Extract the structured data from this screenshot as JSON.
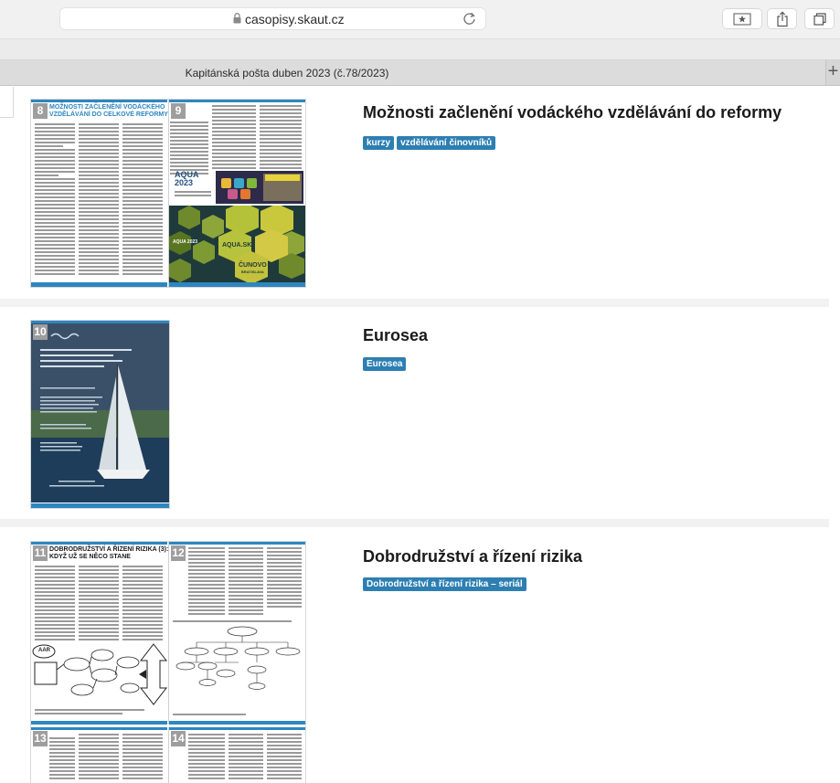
{
  "browser": {
    "url": "casopisy.skaut.cz",
    "tab_title": "Kapitánská pošta duben 2023 (č.78/2023)",
    "new_tab_symbol": "+"
  },
  "articles": [
    {
      "title": "Možnosti začlenění vodáckého vzdělávání do reformy",
      "tags": [
        "kurzy",
        "vzdělávání činovníků"
      ],
      "thumb": {
        "page_left": "8",
        "page_right": "9",
        "heading_line1": "MOŽNOSTI ZAČLENĚNÍ VODÁCKÉHO",
        "heading_line2": "VZDĚLÁVÁNÍ DO CELKOVÉ REFORMY",
        "aqua": "AQUA",
        "aqua_year": "2023",
        "aqua_sk": "AQUA.SK",
        "aqua_2023": "AQUA 2023",
        "cunovo_line1": "ČUNOVO",
        "cunovo_line2": "BRATISLAVA"
      }
    },
    {
      "title": "Eurosea",
      "tags": [
        "Eurosea"
      ],
      "thumb": {
        "page": "10"
      }
    },
    {
      "title": "Dobrodružství a řízení rizika",
      "tags": [
        "Dobrodružství a řízení rizika – seriál"
      ],
      "thumb": {
        "page_left": "11",
        "page_right": "12",
        "page_bl": "13",
        "page_br": "14",
        "heading_line1": "DOBRODRUŽSTVÍ A ŘÍZENÍ RIZIKA (3):",
        "heading_line2": "KDYŽ UŽ SE NĚCO STANE",
        "aar": "AAR"
      }
    }
  ],
  "colors": {
    "tag_bg": "#2d7fb2",
    "magazine_blue": "#2e86c1"
  }
}
